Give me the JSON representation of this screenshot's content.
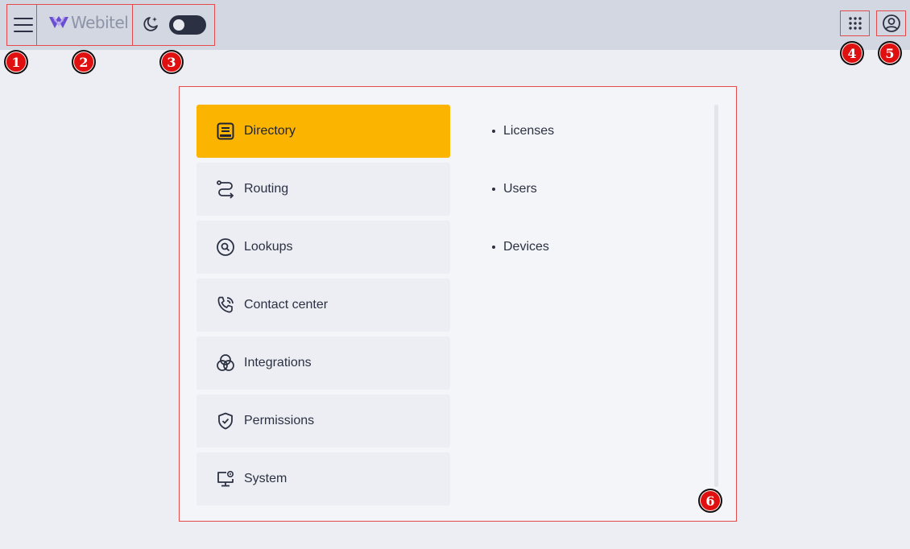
{
  "header": {
    "logo_text": "Webitel",
    "theme_toggle_on": false,
    "brand_color": "#6a4fd3",
    "accent_color": "#fbb400"
  },
  "annotations": [
    "1",
    "2",
    "3",
    "4",
    "5",
    "6"
  ],
  "nav": {
    "items": [
      {
        "label": "Directory",
        "icon": "directory-icon",
        "active": true
      },
      {
        "label": "Routing",
        "icon": "routing-icon",
        "active": false
      },
      {
        "label": "Lookups",
        "icon": "lookups-icon",
        "active": false
      },
      {
        "label": "Contact center",
        "icon": "contact-center-icon",
        "active": false
      },
      {
        "label": "Integrations",
        "icon": "integrations-icon",
        "active": false
      },
      {
        "label": "Permissions",
        "icon": "permissions-icon",
        "active": false
      },
      {
        "label": "System",
        "icon": "system-icon",
        "active": false
      }
    ]
  },
  "subnav": {
    "items": [
      "Licenses",
      "Users",
      "Devices"
    ]
  }
}
